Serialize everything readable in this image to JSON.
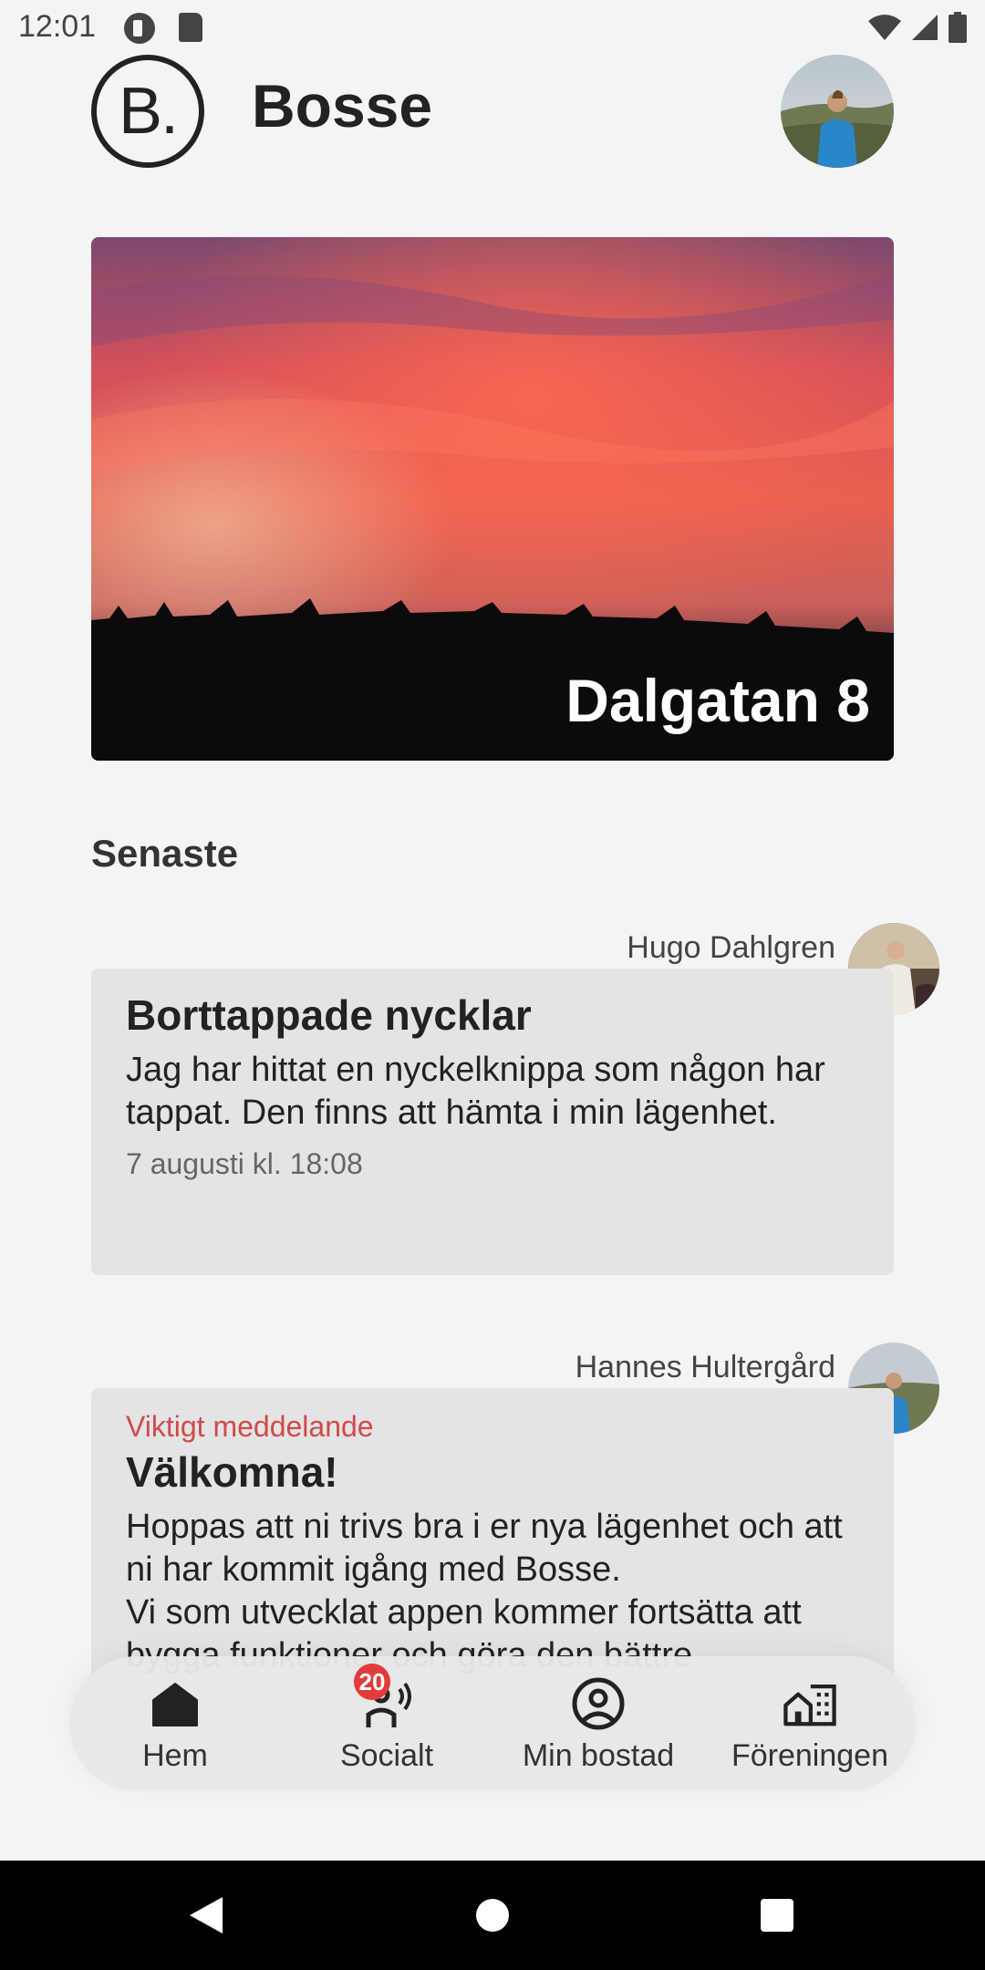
{
  "status": {
    "time": "12:01"
  },
  "header": {
    "title": "Bosse",
    "logo_text": "B."
  },
  "hero": {
    "title": "Dalgatan 8"
  },
  "section": {
    "title": "Senaste"
  },
  "posts": [
    {
      "author": "Hugo Dahlgren",
      "title": "Borttappade nycklar",
      "body": "Jag har hittat en nyckelknippa som någon har tappat. Den finns att hämta i min lägenhet.",
      "date": "7 augusti kl. 18:08"
    },
    {
      "author": "Hannes Hultergård",
      "tag": "Viktigt meddelande",
      "title": "Välkomna!",
      "body": "Hoppas att ni trivs bra i er nya lägenhet och att ni har kommit igång med Bosse.\nVi som utvecklat appen kommer fortsätta att bygga funktioner och göra den bättre"
    }
  ],
  "nav": {
    "items": [
      {
        "label": "Hem",
        "icon": "home-icon"
      },
      {
        "label": "Socialt",
        "icon": "social-icon",
        "badge": "20"
      },
      {
        "label": "Min bostad",
        "icon": "account-circle-icon"
      },
      {
        "label": "Föreningen",
        "icon": "building-icon"
      }
    ]
  },
  "colors": {
    "accent_red": "#cf4a4a",
    "badge_red": "#e33b3b",
    "card_bg": "#e4e4e4",
    "page_bg": "#f4f4f4"
  }
}
